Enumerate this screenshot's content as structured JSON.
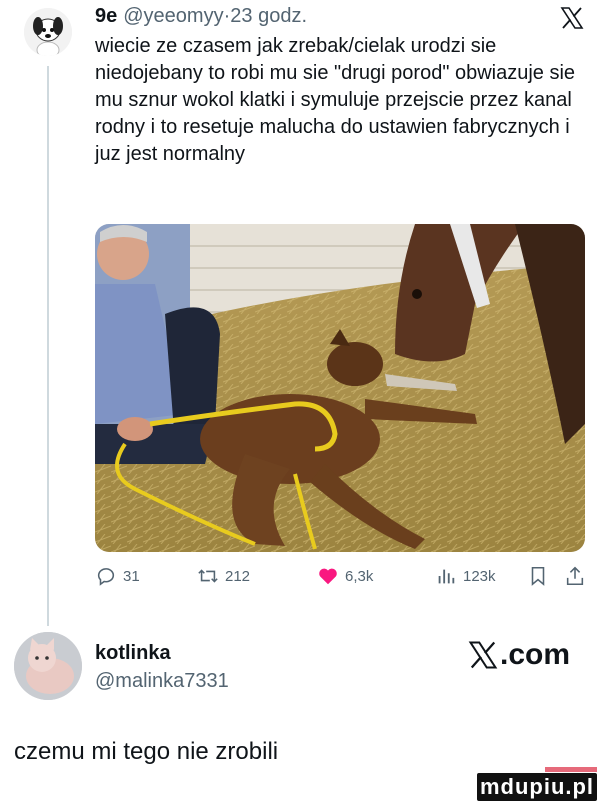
{
  "tweet": {
    "name_badge": "9e",
    "handle": "@yeeomyy",
    "separator": "·",
    "time": "23 godz.",
    "text": "wiecie ze czasem jak zrebak/cielak urodzi sie niedojebany to robi mu sie \"drugi porod\" obwiazuje sie mu sznur wokol klatki i symuluje przejscie przez kanal rodny i to resetuje malucha do ustawien fabrycznych i juz jest normalny"
  },
  "actions": {
    "replies": "31",
    "retweets": "212",
    "likes": "6,3k",
    "views": "123k"
  },
  "colors": {
    "like": "#f91880",
    "muted": "#536471",
    "text": "#0f1419"
  },
  "repost_block": {
    "name": "kotlinka",
    "handle": "@malinka7331",
    "brand": ".com"
  },
  "caption": "czemu mi tego nie zrobili",
  "watermark": "mdupiu.pl"
}
